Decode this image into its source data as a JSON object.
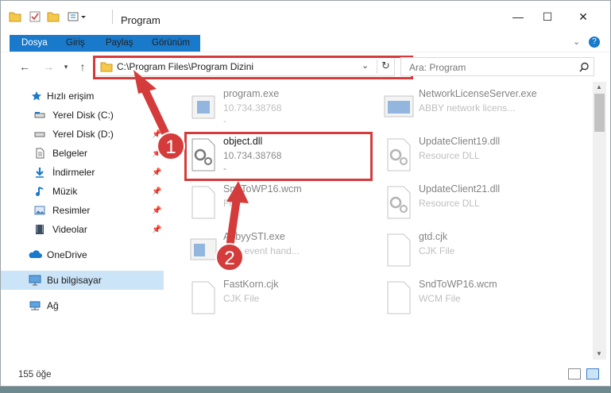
{
  "window": {
    "title": "Program"
  },
  "controls": {
    "minimize": "—",
    "maximize": "☐",
    "close": "✕"
  },
  "ribbon": {
    "tabs": [
      "Dosya",
      "Giriş",
      "Paylaş",
      "Görünüm"
    ]
  },
  "address": {
    "path": "C:\\Program Files\\Program Dizini"
  },
  "search": {
    "placeholder": "Ara: Program"
  },
  "sidebar": {
    "items": [
      {
        "label": "Hızlı erişim",
        "icon": "star-icon"
      },
      {
        "label": "Yerel Disk (C:)",
        "icon": "drive-icon"
      },
      {
        "label": "Yerel Disk (D:)",
        "icon": "drive-icon",
        "pinned": true
      },
      {
        "label": "Belgeler",
        "icon": "document-icon",
        "pinned": true
      },
      {
        "label": "İndirmeler",
        "icon": "download-icon",
        "pinned": true
      },
      {
        "label": "Müzik",
        "icon": "music-icon",
        "pinned": true
      },
      {
        "label": "Resimler",
        "icon": "pictures-icon",
        "pinned": true
      },
      {
        "label": "Videolar",
        "icon": "video-icon",
        "pinned": true
      },
      {
        "label": "OneDrive",
        "icon": "cloud-icon"
      },
      {
        "label": "Bu bilgisayar",
        "icon": "computer-icon",
        "selected": true
      },
      {
        "label": "Ağ",
        "icon": "network-icon"
      }
    ]
  },
  "files": [
    {
      "name": "program.exe",
      "sub1": "10.734.38768",
      "sub2": "-",
      "icon": "exe-icon"
    },
    {
      "name": "NetworkLicenseServer.exe",
      "sub1": "ABBY network licens...",
      "sub2": "",
      "icon": "exe-icon"
    },
    {
      "name": "object.dll",
      "sub1": "10.734.38768",
      "sub2": "-",
      "icon": "dll-icon"
    },
    {
      "name": "UpdateClient19.dll",
      "sub1": "Resource DLL",
      "sub2": "",
      "icon": "dll-icon"
    },
    {
      "name": "SndToWP16.wcm",
      "sub1": "File",
      "sub2": "",
      "icon": "file-icon"
    },
    {
      "name": "UpdateClient21.dll",
      "sub1": "Resource DLL",
      "sub2": "",
      "icon": "dll-icon"
    },
    {
      "name": "AbbyySTI.exe",
      "sub1": "Y sti event hand...",
      "sub2": "",
      "icon": "exe-icon"
    },
    {
      "name": "gtd.cjk",
      "sub1": "CJK File",
      "sub2": "",
      "icon": "file-icon"
    },
    {
      "name": "FastKorn.cjk",
      "sub1": "CJK File",
      "sub2": "",
      "icon": "file-icon"
    },
    {
      "name": "SndToWP16.wcm",
      "sub1": "WCM File",
      "sub2": "",
      "icon": "file-icon"
    }
  ],
  "status": {
    "count": "155 öğe"
  },
  "callouts": {
    "one": "1",
    "two": "2"
  }
}
